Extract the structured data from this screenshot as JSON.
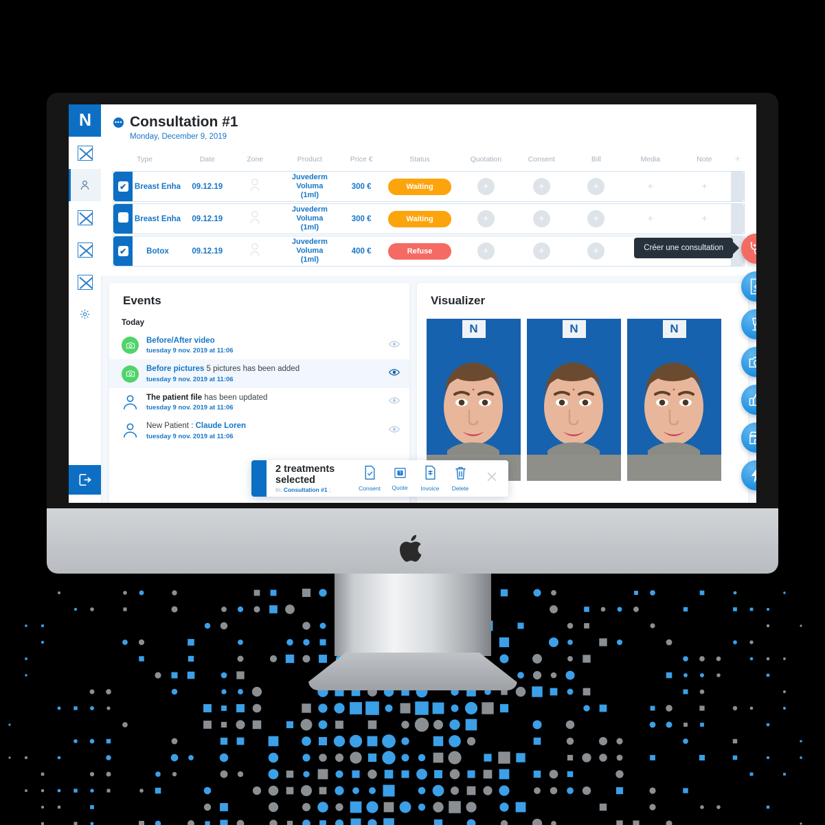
{
  "app": {
    "logo_text": "N",
    "sidebar": {
      "items": [
        {
          "name": "mail-placeholder",
          "icon": "box-x-icon",
          "active": false
        },
        {
          "name": "patients",
          "icon": "user-icon",
          "active": true
        },
        {
          "name": "placeholder-2",
          "icon": "box-x-icon",
          "active": false
        },
        {
          "name": "placeholder-3",
          "icon": "box-x-icon",
          "active": false
        },
        {
          "name": "placeholder-4",
          "icon": "box-x-icon",
          "active": false
        },
        {
          "name": "settings",
          "icon": "gear-icon",
          "active": false
        }
      ],
      "logout_icon": "logout-icon"
    }
  },
  "consultation": {
    "badge_icon": "dots-icon",
    "title": "Consultation #1",
    "date": "Monday, December 9, 2019",
    "columns": [
      "Type",
      "Date",
      "Zone",
      "Product",
      "Price €",
      "Status",
      "Quotation",
      "Consent",
      "Bill",
      "Media",
      "Note"
    ],
    "add_column_icon": "plus-icon",
    "rows": [
      {
        "checked": true,
        "type": "Breast Enha",
        "date": "09.12.19",
        "zone_icon": "head-outline-icon",
        "product": "Juvederm Voluma (1ml)",
        "price": "300 €",
        "status": "Waiting",
        "status_color": "#FBA40B",
        "quotation": "plus-circle-icon",
        "consent": "plus-circle-icon",
        "bill": "plus-circle-icon",
        "media": "plus-icon",
        "note": "plus-icon"
      },
      {
        "checked": false,
        "type": "Breast Enha",
        "date": "09.12.19",
        "zone_icon": "head-outline-icon",
        "product": "Juvederm Voluma (1ml)",
        "price": "300 €",
        "status": "Waiting",
        "status_color": "#FBA40B",
        "quotation": "plus-circle-icon",
        "consent": "plus-circle-icon",
        "bill": "plus-circle-icon",
        "media": "plus-icon",
        "note": "plus-icon"
      },
      {
        "checked": true,
        "type": "Botox",
        "date": "09.12.19",
        "zone_icon": "head-outline-icon",
        "product": "Juvederm Voluma (1ml)",
        "price": "400 €",
        "status": "Refuse",
        "status_color": "#F46B63",
        "quotation": "plus-circle-icon",
        "consent": "plus-circle-icon",
        "bill": "plus-circle-icon",
        "media": "plus-icon",
        "note": "plus-icon"
      }
    ]
  },
  "events": {
    "title": "Events",
    "group_label": "Today",
    "items": [
      {
        "icon": "camera-icon",
        "icon_style": "green",
        "title": "Before/After video",
        "title_style": "blue",
        "rest": "",
        "timestamp": "tuesday 9 nov. 2019 at 11:06",
        "eye_icon": "eye-icon",
        "highlighted": false
      },
      {
        "icon": "camera-icon",
        "icon_style": "green",
        "title": "Before pictures",
        "title_style": "blue",
        "rest": " 5 pictures has been added",
        "timestamp": "tuesday 9 nov. 2019 at 11:06",
        "eye_icon": "eye-icon",
        "highlighted": true
      },
      {
        "icon": "user-icon",
        "icon_style": "outline",
        "title": "The patient file",
        "title_style": "dark",
        "rest": " has been updated",
        "timestamp": "tuesday 9 nov. 2019 at 11:06",
        "eye_icon": "eye-icon",
        "highlighted": false
      },
      {
        "icon": "user-icon",
        "icon_style": "outline",
        "title": "",
        "title_style": "dark",
        "prefix": "New Patient : ",
        "rest": "Claude Loren",
        "timestamp": "tuesday 9 nov. 2019 at 11:06",
        "eye_icon": "eye-icon",
        "highlighted": false
      }
    ]
  },
  "visualizer": {
    "title": "Visualizer",
    "photos": [
      {
        "watermark": "N",
        "alt": "patient-front-view-1"
      },
      {
        "watermark": "N",
        "alt": "patient-front-view-2"
      },
      {
        "watermark": "N",
        "alt": "patient-front-view-3"
      }
    ]
  },
  "fabs": {
    "tooltip": "Créer une consultation",
    "buttons": [
      {
        "name": "create-consultation-fab",
        "icon": "stethoscope-plus-icon",
        "color": "#F26C63"
      },
      {
        "name": "create-document-fab",
        "icon": "document-plus-icon",
        "color": "#1E8FDF"
      },
      {
        "name": "create-injection-fab",
        "icon": "iv-drip-plus-icon",
        "color": "#1E8FDF"
      },
      {
        "name": "add-photo-fab",
        "icon": "camera-icon",
        "color": "#1E8FDF"
      },
      {
        "name": "satisfaction-fab",
        "icon": "thumbs-up-icon",
        "color": "#1E8FDF"
      },
      {
        "name": "store-fab",
        "icon": "store-icon",
        "color": "#1E8FDF"
      },
      {
        "name": "quick-action-fab",
        "icon": "lightning-icon",
        "color": "#1E8FDF"
      }
    ]
  },
  "selection_bar": {
    "heading": "2 treatments selected",
    "sub_prefix": "In: ",
    "sub_link": "Consultation #1",
    "sub_suffix": " ;",
    "actions": [
      {
        "label": "Consent",
        "icon": "document-check-icon"
      },
      {
        "label": "Quote",
        "icon": "quote-icon"
      },
      {
        "label": "Invoice",
        "icon": "invoice-icon"
      },
      {
        "label": "Delete",
        "icon": "trash-icon"
      }
    ],
    "close_icon": "close-icon"
  },
  "colors": {
    "brand_blue": "#0D6FC4",
    "link_blue": "#1676C8",
    "orange": "#FBA40B",
    "red": "#F46B63",
    "green": "#4FD469",
    "dot_blue": "#3BA0E8",
    "dot_gray": "#8A8F94"
  }
}
